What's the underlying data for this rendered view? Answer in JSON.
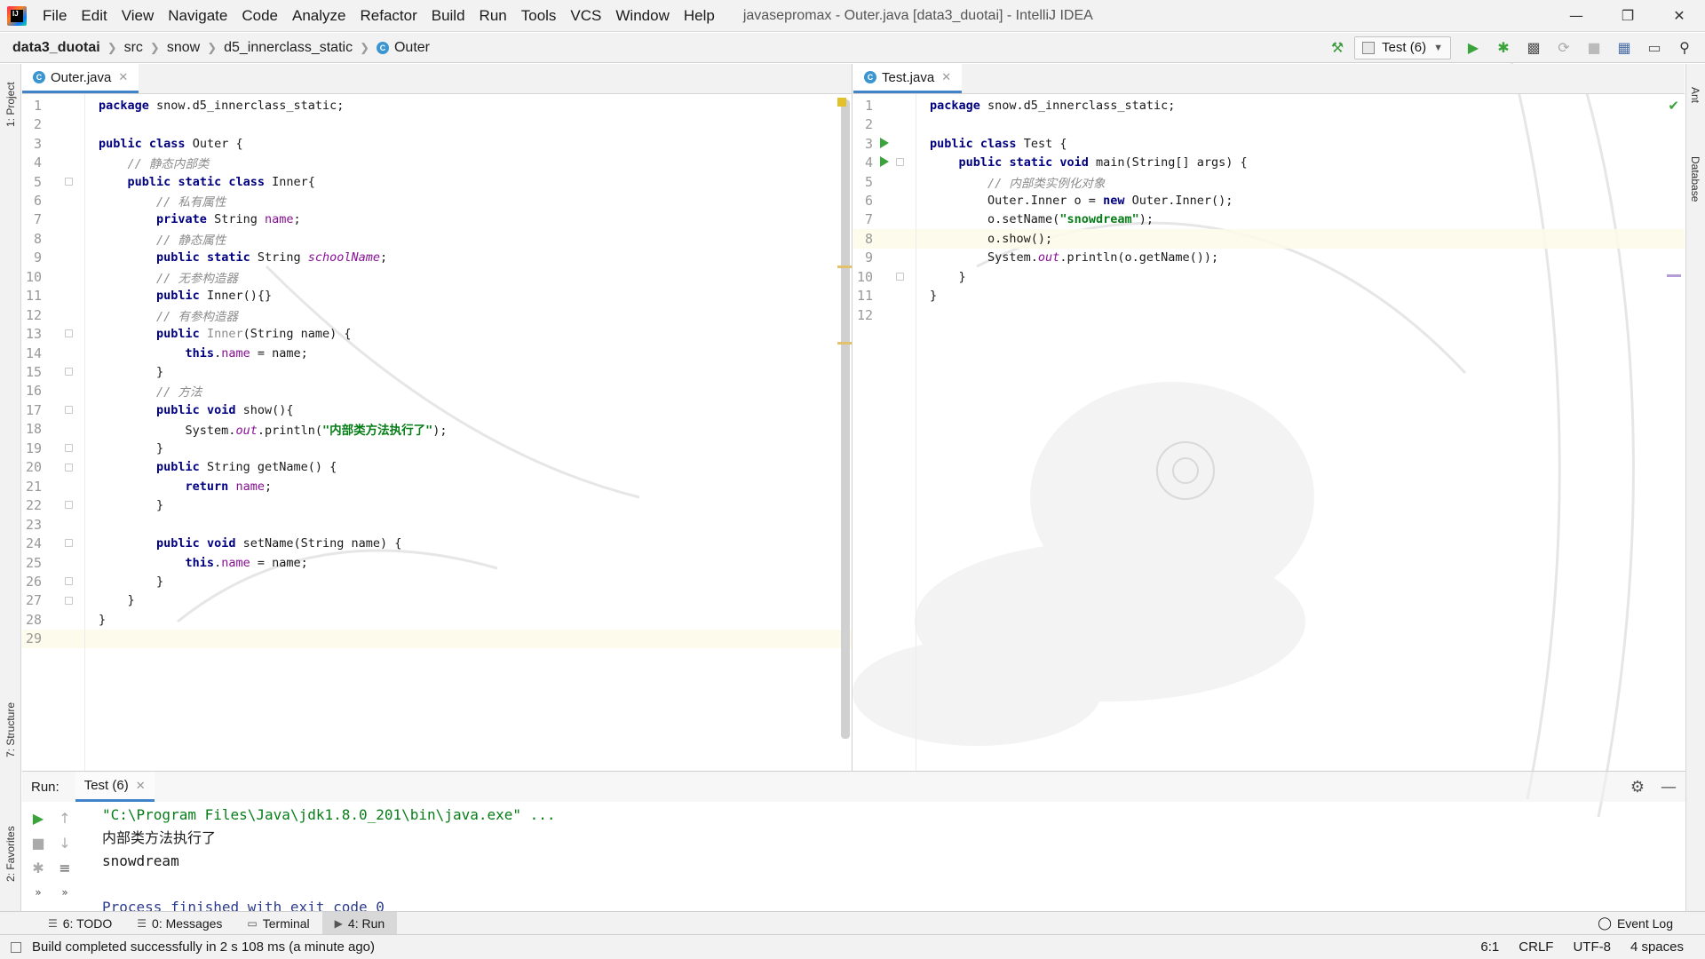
{
  "menu": {
    "items": [
      "File",
      "Edit",
      "View",
      "Navigate",
      "Code",
      "Analyze",
      "Refactor",
      "Build",
      "Run",
      "Tools",
      "VCS",
      "Window",
      "Help"
    ],
    "window_title": "javasepromax - Outer.java [data3_duotai] - IntelliJ IDEA"
  },
  "navbar": {
    "crumbs": [
      "data3_duotai",
      "src",
      "snow",
      "d5_innerclass_static",
      "Outer"
    ],
    "run_config": "Test (6)"
  },
  "left_strip": {
    "project": "1: Project",
    "structure": "7: Structure",
    "favorites": "2: Favorites"
  },
  "right_strip": {
    "ant": "Ant",
    "database": "Database"
  },
  "editor_left": {
    "tab": "Outer.java",
    "lines": [
      "package snow.d5_innerclass_static;",
      "",
      "public class Outer {",
      "    // 静态内部类",
      "    public static class Inner{",
      "        // 私有属性",
      "        private String name;",
      "        // 静态属性",
      "        public static String schoolName;",
      "        // 无参构造器",
      "        public Inner(){}",
      "        // 有参构造器",
      "        public Inner(String name) {",
      "            this.name = name;",
      "        }",
      "        // 方法",
      "        public void show(){",
      "            System.out.println(\"内部类方法执行了\");",
      "        }",
      "        public String getName() {",
      "            return name;",
      "        }",
      "",
      "        public void setName(String name) {",
      "            this.name = name;",
      "        }",
      "    }",
      "}",
      ""
    ]
  },
  "editor_right": {
    "tab": "Test.java",
    "lines": [
      "package snow.d5_innerclass_static;",
      "",
      "public class Test {",
      "    public static void main(String[] args) {",
      "        // 内部类实例化对象",
      "        Outer.Inner o = new Outer.Inner();",
      "        o.setName(\"snowdream\");",
      "        o.show();",
      "        System.out.println(o.getName());",
      "    }",
      "}",
      ""
    ]
  },
  "run_panel": {
    "label": "Run:",
    "tab": "Test (6)",
    "console": [
      "\"C:\\Program Files\\Java\\jdk1.8.0_201\\bin\\java.exe\" ...",
      "内部类方法执行了",
      "snowdream",
      "",
      "Process finished with exit code 0"
    ]
  },
  "bottom_tabs": [
    "6: TODO",
    "0: Messages",
    "Terminal",
    "4: Run"
  ],
  "event_log": "Event Log",
  "status": {
    "message": "Build completed successfully in 2 s 108 ms (a minute ago)",
    "position": "6:1",
    "line_sep": "CRLF",
    "encoding": "UTF-8",
    "indent": "4 spaces"
  },
  "colors": {
    "keyword": "#000080",
    "string": "#067d17",
    "comment": "#8c8c8c",
    "field": "#871094",
    "accent": "#4083c9"
  }
}
